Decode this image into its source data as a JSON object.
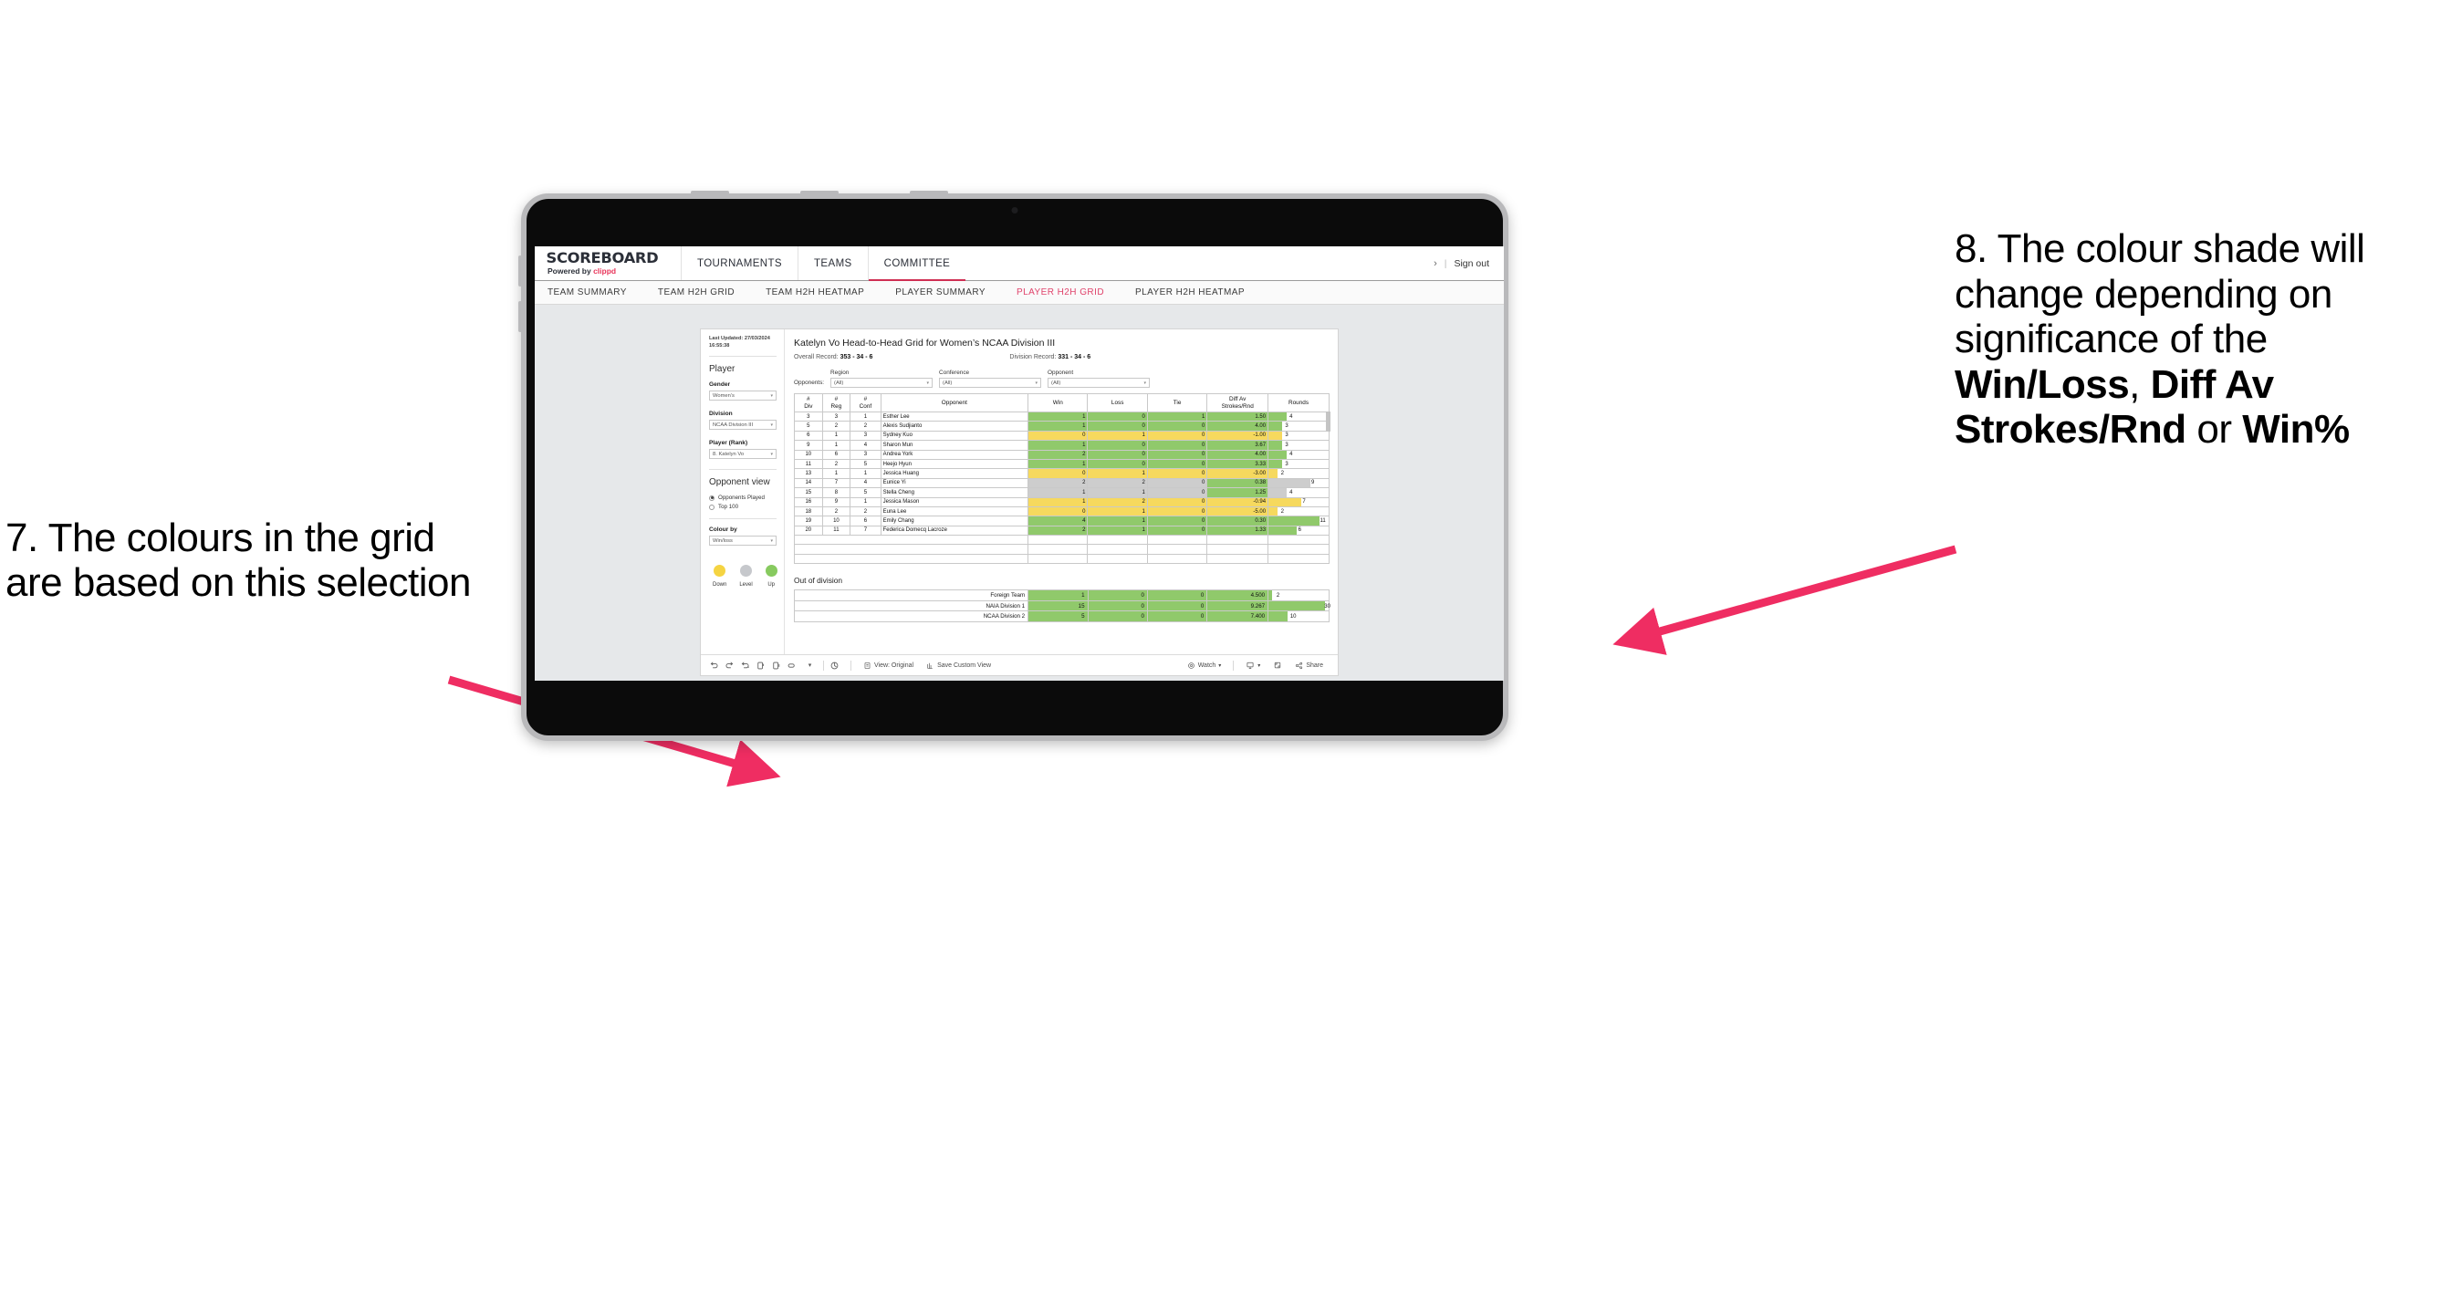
{
  "annotations": {
    "left": "7. The colours in the grid are based on this selection",
    "right_pre": "8. The colour shade will change depending on significance of the ",
    "right_b1": "Win/Loss",
    "right_mid1": ", ",
    "right_b2": "Diff Av Strokes/Rnd",
    "right_mid2": " or ",
    "right_b3": "Win%",
    "arrow_color": "#ef2d62"
  },
  "topnav": {
    "brand_title": "SCOREBOARD",
    "brand_sub_pre": "Powered by ",
    "brand_sub_accent": "clippd",
    "tabs": [
      {
        "label": "TOURNAMENTS",
        "active": false
      },
      {
        "label": "TEAMS",
        "active": false
      },
      {
        "label": "COMMITTEE",
        "active": true
      }
    ],
    "chevron": "›",
    "pipe": "|",
    "signout": "Sign out"
  },
  "subnav": {
    "tabs": [
      {
        "label": "TEAM SUMMARY",
        "active": false
      },
      {
        "label": "TEAM H2H GRID",
        "active": false
      },
      {
        "label": "TEAM H2H HEATMAP",
        "active": false
      },
      {
        "label": "PLAYER SUMMARY",
        "active": false
      },
      {
        "label": "PLAYER H2H GRID",
        "active": true
      },
      {
        "label": "PLAYER H2H HEATMAP",
        "active": false
      }
    ],
    "active_color": "#e0436b"
  },
  "sidebar": {
    "last_updated": "Last Updated: 27/03/2024 16:55:38",
    "section_player": "Player",
    "filters": [
      {
        "label": "Gender",
        "value": "Women’s"
      },
      {
        "label": "Division",
        "value": "NCAA Division III"
      },
      {
        "label": "Player (Rank)",
        "value": "8. Katelyn Vo"
      }
    ],
    "opponent_view": {
      "title": "Opponent view",
      "options": [
        {
          "label": "Opponents Played",
          "selected": true
        },
        {
          "label": "Top 100",
          "selected": false
        }
      ]
    },
    "colour_by": {
      "label": "Colour by",
      "value": "Win/loss"
    },
    "legend": [
      {
        "label": "Down",
        "color": "#f5d442"
      },
      {
        "label": "Level",
        "color": "#c6c8cc"
      },
      {
        "label": "Up",
        "color": "#87ca5f"
      }
    ]
  },
  "main": {
    "title": "Katelyn Vo Head-to-Head Grid for Women’s NCAA Division III",
    "overall_record_label": "Overall Record:",
    "overall_record_value": "353 -  34 - 6",
    "division_record_label": "Division Record:",
    "division_record_value": "331 -  34 - 6",
    "opponents_label": "Opponents:",
    "opponent_filters": [
      {
        "label": "Region",
        "value": "(All)"
      },
      {
        "label": "Conference",
        "value": "(All)"
      },
      {
        "label": "Opponent",
        "value": "(All)"
      }
    ]
  },
  "chart_data": {
    "type": "table",
    "title": "Katelyn Vo Head-to-Head Grid for Women’s NCAA Division III",
    "columns": [
      "# Div",
      "# Reg",
      "# Conf",
      "Opponent",
      "Win",
      "Loss",
      "Tie",
      "Diff Av Strokes/Rnd",
      "Rounds"
    ],
    "column_header_lines": [
      [
        "#",
        "Div"
      ],
      [
        "#",
        "Reg"
      ],
      [
        "#",
        "Conf"
      ],
      [
        "Opponent",
        ""
      ],
      [
        "Win",
        ""
      ],
      [
        "Loss",
        ""
      ],
      [
        "Tie",
        ""
      ],
      [
        "Diff Av",
        "Strokes/Rnd"
      ],
      [
        "Rounds",
        ""
      ]
    ],
    "colors": {
      "up": "#90c96b",
      "down": "#f6d95e",
      "level": "#cdcdcd",
      "none": "#ffffff"
    },
    "rounds_max": 13,
    "rows": [
      {
        "div": "3",
        "reg": "3",
        "conf": "1",
        "opponent": "Esther Lee",
        "win": "1",
        "loss": "0",
        "tie": "1",
        "diff": "1.50",
        "rounds": "4",
        "shade": "up",
        "rounds_shade": "up"
      },
      {
        "div": "5",
        "reg": "2",
        "conf": "2",
        "opponent": "Alexis Sudjianto",
        "win": "1",
        "loss": "0",
        "tie": "0",
        "diff": "4.00",
        "rounds": "3",
        "shade": "up",
        "rounds_shade": "up"
      },
      {
        "div": "6",
        "reg": "1",
        "conf": "3",
        "opponent": "Sydney Kuo",
        "win": "0",
        "loss": "1",
        "tie": "0",
        "diff": "-1.00",
        "rounds": "3",
        "shade": "down",
        "rounds_shade": "down"
      },
      {
        "div": "9",
        "reg": "1",
        "conf": "4",
        "opponent": "Sharon Mun",
        "win": "1",
        "loss": "0",
        "tie": "0",
        "diff": "3.67",
        "rounds": "3",
        "shade": "up",
        "rounds_shade": "up"
      },
      {
        "div": "10",
        "reg": "6",
        "conf": "3",
        "opponent": "Andrea York",
        "win": "2",
        "loss": "0",
        "tie": "0",
        "diff": "4.00",
        "rounds": "4",
        "shade": "up",
        "rounds_shade": "up"
      },
      {
        "div": "11",
        "reg": "2",
        "conf": "5",
        "opponent": "Heejo Hyun",
        "win": "1",
        "loss": "0",
        "tie": "0",
        "diff": "3.33",
        "rounds": "3",
        "shade": "up",
        "rounds_shade": "up"
      },
      {
        "div": "13",
        "reg": "1",
        "conf": "1",
        "opponent": "Jessica Huang",
        "win": "0",
        "loss": "1",
        "tie": "0",
        "diff": "-3.00",
        "rounds": "2",
        "shade": "down",
        "rounds_shade": "down"
      },
      {
        "div": "14",
        "reg": "7",
        "conf": "4",
        "opponent": "Eunice Yi",
        "win": "2",
        "loss": "2",
        "tie": "0",
        "diff": "0.38",
        "rounds": "9",
        "shade": "level",
        "rounds_shade": "level",
        "diff_shade": "up"
      },
      {
        "div": "15",
        "reg": "8",
        "conf": "5",
        "opponent": "Stella Cheng",
        "win": "1",
        "loss": "1",
        "tie": "0",
        "diff": "1.25",
        "rounds": "4",
        "shade": "level",
        "rounds_shade": "level",
        "diff_shade": "up"
      },
      {
        "div": "16",
        "reg": "9",
        "conf": "1",
        "opponent": "Jessica Mason",
        "win": "1",
        "loss": "2",
        "tie": "0",
        "diff": "-0.94",
        "rounds": "7",
        "shade": "down",
        "rounds_shade": "down"
      },
      {
        "div": "18",
        "reg": "2",
        "conf": "2",
        "opponent": "Euna Lee",
        "win": "0",
        "loss": "1",
        "tie": "0",
        "diff": "-5.00",
        "rounds": "2",
        "shade": "down",
        "rounds_shade": "down"
      },
      {
        "div": "19",
        "reg": "10",
        "conf": "6",
        "opponent": "Emily Chang",
        "win": "4",
        "loss": "1",
        "tie": "0",
        "diff": "0.30",
        "rounds": "11",
        "shade": "up",
        "rounds_shade": "up"
      },
      {
        "div": "20",
        "reg": "11",
        "conf": "7",
        "opponent": "Federica Domecq Lacroze",
        "win": "2",
        "loss": "1",
        "tie": "0",
        "diff": "1.33",
        "rounds": "6",
        "shade": "up",
        "rounds_shade": "up"
      }
    ]
  },
  "out_of_division": {
    "title": "Out of division",
    "rounds_max": 32,
    "rows": [
      {
        "name": "Foreign Team",
        "win": "1",
        "loss": "0",
        "tie": "0",
        "diff": "4.500",
        "rounds": "2",
        "shade": "up"
      },
      {
        "name": "NAIA Division 1",
        "win": "15",
        "loss": "0",
        "tie": "0",
        "diff": "9.267",
        "rounds": "30",
        "shade": "up"
      },
      {
        "name": "NCAA Division 2",
        "win": "5",
        "loss": "0",
        "tie": "0",
        "diff": "7.400",
        "rounds": "10",
        "shade": "up"
      }
    ]
  },
  "toolbar": {
    "view_label": "View: Original",
    "save_label": "Save Custom View",
    "watch_label": "Watch",
    "share_label": "Share"
  }
}
